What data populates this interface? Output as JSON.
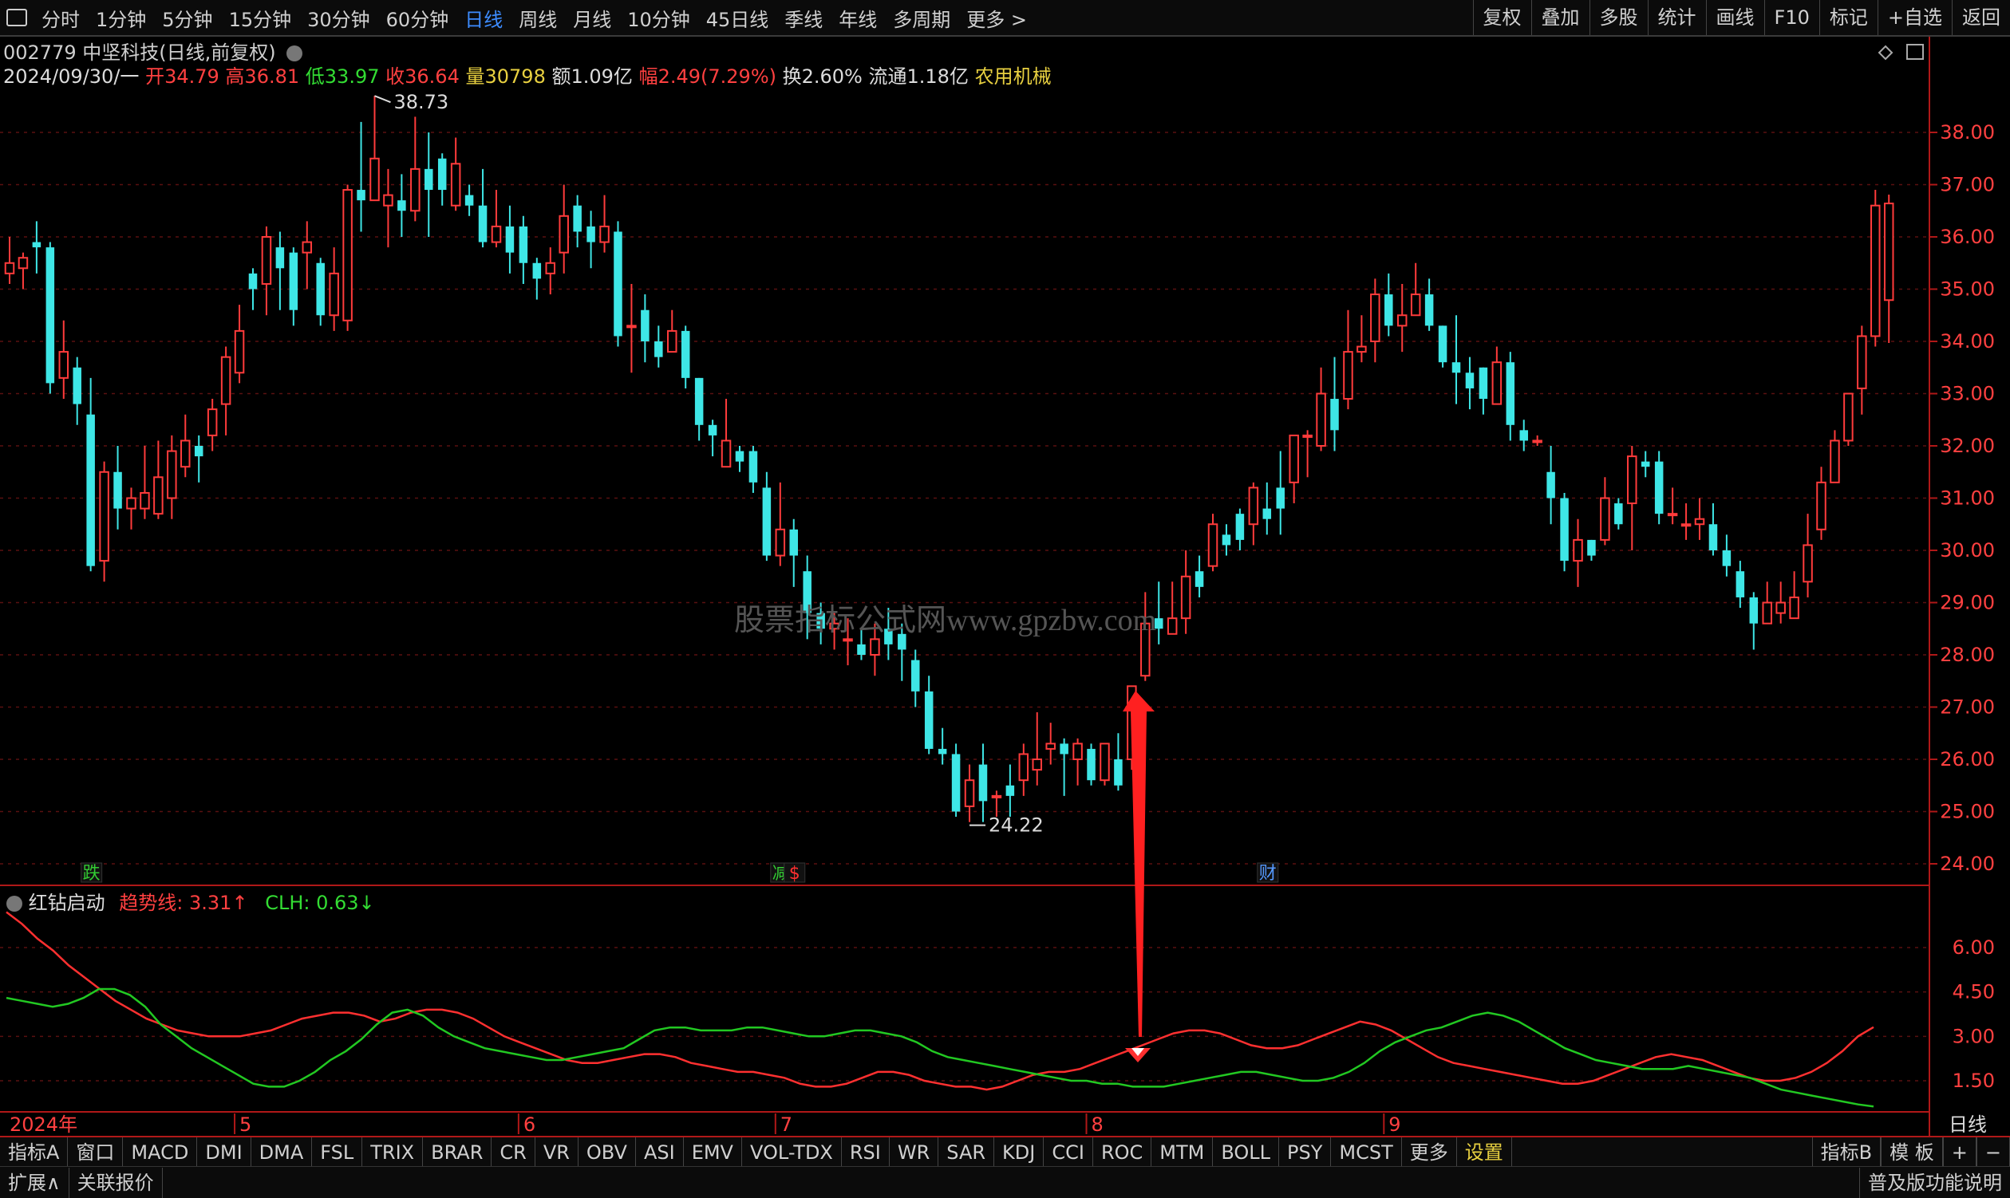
{
  "topbar": {
    "periods": [
      "分时",
      "1分钟",
      "5分钟",
      "15分钟",
      "30分钟",
      "60分钟",
      "日线",
      "周线",
      "月线",
      "10分钟",
      "45日线",
      "季线",
      "年线",
      "多周期",
      "更多 >"
    ],
    "active_period": "日线",
    "right_tools": [
      "复权",
      "叠加",
      "多股",
      "统计",
      "画线",
      "F10",
      "标记",
      "+自选",
      "返回"
    ]
  },
  "stock": {
    "title": "002779 中坚科技(日线,前复权)",
    "date": "2024/09/30/一",
    "open_label": "开",
    "open": "34.79",
    "high_label": "高",
    "high": "36.81",
    "low_label": "低",
    "low": "33.97",
    "close_label": "收",
    "close": "36.64",
    "vol_label": "量",
    "vol": "30798",
    "amount": "额1.09亿",
    "change_label": "幅",
    "change": "2.49(7.29%)",
    "turnover": "换2.60%",
    "float": "流通1.18亿",
    "sector": "农用机械"
  },
  "watermark": "股票指标公式网www.gpzbw.com",
  "colors": {
    "up": "#ff3b3b",
    "down": "#3ee6e6",
    "grid": "#5a1010",
    "axis": "#b01818",
    "trend": "#ff3030",
    "clh": "#22c822"
  },
  "indicator": {
    "name": "红钻启动",
    "trend_label": "趋势线:",
    "trend_value": "3.31",
    "clh_label": "CLH:",
    "clh_value": "0.63"
  },
  "chart_data": {
    "type": "candlestick",
    "price_axis_ticks": [
      "38.00",
      "37.00",
      "36.00",
      "35.00",
      "34.00",
      "33.00",
      "32.00",
      "31.00",
      "30.00",
      "29.00",
      "28.00",
      "27.00",
      "26.00",
      "25.00",
      "24.00"
    ],
    "price_range": [
      23.8,
      39.5
    ],
    "indicator_ticks": [
      "6.00",
      "4.50",
      "3.00",
      "1.50"
    ],
    "indicator_range": [
      0.6,
      7.6
    ],
    "month_labels": [
      [
        "2024年",
        0
      ],
      [
        "5",
        17
      ],
      [
        "6",
        38
      ],
      [
        "7",
        57
      ],
      [
        "8",
        80
      ],
      [
        "9",
        102
      ]
    ],
    "annotations": {
      "high": "38.73",
      "low": "24.22"
    },
    "event_marks": [
      [
        "跌",
        6,
        "#33cc33"
      ],
      [
        "减",
        57,
        "#33cc33"
      ],
      [
        "$",
        58,
        "#ff3030"
      ],
      [
        "财",
        93,
        "#5599ff"
      ]
    ],
    "candles": [
      [
        35.3,
        35.5,
        35.1,
        36.0
      ],
      [
        35.4,
        35.6,
        35.0,
        35.7
      ],
      [
        35.9,
        35.8,
        35.3,
        36.3
      ],
      [
        35.8,
        33.2,
        33.0,
        35.9
      ],
      [
        33.3,
        33.8,
        32.9,
        34.4
      ],
      [
        33.5,
        32.8,
        32.4,
        33.7
      ],
      [
        32.6,
        29.7,
        29.6,
        33.3
      ],
      [
        29.8,
        31.5,
        29.4,
        31.7
      ],
      [
        31.5,
        30.8,
        30.4,
        32.0
      ],
      [
        30.8,
        31.0,
        30.4,
        31.2
      ],
      [
        30.8,
        31.1,
        30.6,
        32.0
      ],
      [
        30.7,
        31.4,
        30.6,
        32.1
      ],
      [
        31.0,
        31.9,
        30.6,
        32.2
      ],
      [
        31.6,
        32.1,
        31.4,
        32.6
      ],
      [
        32.0,
        31.8,
        31.3,
        32.2
      ],
      [
        32.2,
        32.7,
        31.9,
        32.9
      ],
      [
        32.8,
        33.7,
        32.2,
        33.9
      ],
      [
        33.4,
        34.2,
        33.2,
        34.7
      ],
      [
        35.3,
        35.0,
        34.6,
        35.4
      ],
      [
        35.1,
        36.0,
        34.5,
        36.2
      ],
      [
        35.8,
        35.4,
        34.6,
        36.1
      ],
      [
        35.7,
        34.6,
        34.3,
        35.8
      ],
      [
        35.7,
        35.9,
        35.0,
        36.3
      ],
      [
        35.5,
        34.5,
        34.3,
        35.6
      ],
      [
        34.5,
        35.3,
        34.2,
        35.8
      ],
      [
        34.4,
        36.9,
        34.2,
        37.0
      ],
      [
        36.9,
        36.7,
        36.1,
        38.2
      ],
      [
        36.7,
        37.5,
        36.7,
        38.7
      ],
      [
        36.6,
        36.8,
        35.8,
        37.3
      ],
      [
        36.7,
        36.5,
        36.0,
        37.2
      ],
      [
        36.5,
        37.3,
        36.3,
        38.3
      ],
      [
        37.3,
        36.9,
        36.0,
        38.0
      ],
      [
        37.5,
        36.9,
        36.6,
        37.6
      ],
      [
        36.6,
        37.4,
        36.5,
        37.9
      ],
      [
        36.8,
        36.6,
        36.4,
        37.0
      ],
      [
        36.6,
        35.9,
        35.8,
        37.3
      ],
      [
        35.9,
        36.2,
        35.8,
        36.9
      ],
      [
        36.2,
        35.7,
        35.3,
        36.6
      ],
      [
        36.2,
        35.5,
        35.1,
        36.4
      ],
      [
        35.5,
        35.2,
        34.8,
        35.6
      ],
      [
        35.3,
        35.5,
        34.9,
        35.8
      ],
      [
        35.7,
        36.4,
        35.3,
        37.0
      ],
      [
        36.6,
        36.1,
        35.8,
        36.8
      ],
      [
        36.2,
        35.9,
        35.4,
        36.5
      ],
      [
        35.9,
        36.2,
        35.7,
        36.8
      ],
      [
        36.1,
        34.1,
        33.9,
        36.3
      ],
      [
        34.3,
        34.3,
        33.4,
        35.1
      ],
      [
        34.6,
        34.0,
        33.6,
        34.9
      ],
      [
        34.0,
        33.7,
        33.5,
        34.3
      ],
      [
        33.8,
        34.2,
        33.8,
        34.6
      ],
      [
        34.2,
        33.3,
        33.1,
        34.3
      ],
      [
        33.3,
        32.4,
        32.1,
        33.3
      ],
      [
        32.4,
        32.2,
        31.8,
        32.5
      ],
      [
        31.6,
        32.1,
        31.6,
        32.9
      ],
      [
        31.9,
        31.7,
        31.5,
        32.0
      ],
      [
        31.9,
        31.3,
        31.1,
        32.0
      ],
      [
        31.2,
        29.9,
        29.8,
        31.5
      ],
      [
        29.9,
        30.4,
        29.7,
        31.3
      ],
      [
        30.4,
        29.9,
        29.3,
        30.6
      ],
      [
        29.6,
        28.8,
        28.3,
        29.9
      ],
      [
        28.8,
        28.5,
        28.2,
        29.0
      ],
      [
        28.5,
        28.6,
        28.1,
        28.8
      ],
      [
        28.3,
        28.3,
        27.8,
        28.7
      ],
      [
        28.2,
        28.0,
        27.9,
        28.5
      ],
      [
        28.0,
        28.3,
        27.6,
        28.6
      ],
      [
        28.5,
        28.2,
        27.9,
        28.9
      ],
      [
        28.4,
        28.1,
        27.5,
        28.6
      ],
      [
        27.9,
        27.3,
        27.0,
        28.1
      ],
      [
        27.3,
        26.2,
        26.1,
        27.6
      ],
      [
        26.2,
        26.1,
        25.9,
        26.6
      ],
      [
        26.1,
        25.0,
        24.9,
        26.3
      ],
      [
        25.1,
        25.6,
        24.8,
        25.9
      ],
      [
        25.9,
        25.2,
        24.8,
        26.3
      ],
      [
        25.3,
        25.3,
        24.9,
        25.4
      ],
      [
        25.5,
        25.3,
        24.9,
        25.9
      ],
      [
        25.6,
        26.1,
        25.3,
        26.3
      ],
      [
        25.8,
        26.0,
        25.5,
        26.9
      ],
      [
        26.2,
        26.3,
        25.9,
        26.7
      ],
      [
        26.3,
        26.1,
        25.3,
        26.4
      ],
      [
        26.0,
        26.3,
        25.5,
        26.4
      ],
      [
        26.2,
        25.6,
        25.5,
        26.3
      ],
      [
        25.6,
        26.3,
        25.5,
        26.3
      ],
      [
        26.0,
        25.5,
        25.4,
        26.5
      ],
      [
        26.0,
        27.4,
        25.8,
        27.4
      ],
      [
        27.6,
        28.6,
        27.5,
        29.2
      ],
      [
        28.7,
        28.5,
        28.2,
        29.4
      ],
      [
        28.4,
        28.7,
        28.4,
        29.4
      ],
      [
        28.7,
        29.5,
        28.4,
        30.0
      ],
      [
        29.6,
        29.3,
        29.1,
        29.9
      ],
      [
        29.7,
        30.5,
        29.6,
        30.7
      ],
      [
        30.3,
        30.1,
        29.9,
        30.5
      ],
      [
        30.7,
        30.2,
        30.0,
        30.8
      ],
      [
        30.5,
        31.2,
        30.1,
        31.3
      ],
      [
        30.8,
        30.6,
        30.3,
        31.3
      ],
      [
        31.2,
        30.8,
        30.3,
        31.9
      ],
      [
        31.3,
        32.2,
        30.9,
        32.2
      ],
      [
        32.2,
        32.2,
        31.4,
        32.3
      ],
      [
        32.0,
        33.0,
        31.9,
        33.5
      ],
      [
        32.9,
        32.3,
        31.9,
        33.7
      ],
      [
        32.9,
        33.8,
        32.7,
        34.6
      ],
      [
        33.8,
        33.9,
        33.6,
        34.5
      ],
      [
        34.0,
        34.9,
        33.6,
        35.2
      ],
      [
        34.9,
        34.3,
        34.1,
        35.3
      ],
      [
        34.3,
        34.5,
        33.8,
        35.1
      ],
      [
        34.5,
        34.9,
        34.5,
        35.5
      ],
      [
        34.9,
        34.3,
        34.2,
        35.2
      ],
      [
        34.3,
        33.6,
        33.5,
        34.3
      ],
      [
        33.6,
        33.4,
        32.8,
        34.5
      ],
      [
        33.4,
        33.1,
        32.7,
        33.7
      ],
      [
        33.5,
        32.9,
        32.6,
        33.5
      ],
      [
        32.8,
        33.6,
        32.8,
        33.9
      ],
      [
        33.6,
        32.4,
        32.1,
        33.8
      ],
      [
        32.3,
        32.1,
        31.9,
        32.5
      ],
      [
        32.1,
        32.1,
        32.0,
        32.2
      ],
      [
        31.5,
        31.0,
        30.5,
        32.0
      ],
      [
        31.0,
        29.8,
        29.6,
        31.1
      ],
      [
        29.8,
        30.2,
        29.3,
        30.6
      ],
      [
        30.2,
        29.9,
        29.8,
        30.2
      ],
      [
        30.2,
        31.0,
        30.1,
        31.4
      ],
      [
        30.9,
        30.5,
        30.4,
        31.0
      ],
      [
        30.9,
        31.8,
        30.0,
        32.0
      ],
      [
        31.7,
        31.6,
        31.4,
        31.9
      ],
      [
        31.7,
        30.7,
        30.5,
        31.9
      ],
      [
        30.7,
        30.7,
        30.5,
        31.2
      ],
      [
        30.5,
        30.5,
        30.2,
        30.9
      ],
      [
        30.5,
        30.6,
        30.2,
        31.0
      ],
      [
        30.5,
        30.0,
        29.9,
        30.9
      ],
      [
        30.0,
        29.7,
        29.5,
        30.3
      ],
      [
        29.6,
        29.1,
        28.9,
        29.8
      ],
      [
        29.1,
        28.6,
        28.1,
        29.2
      ],
      [
        28.6,
        29.0,
        28.6,
        29.4
      ],
      [
        28.8,
        29.0,
        28.6,
        29.4
      ],
      [
        28.7,
        29.1,
        28.7,
        29.6
      ],
      [
        29.4,
        30.1,
        29.1,
        30.7
      ],
      [
        30.4,
        31.3,
        30.2,
        31.6
      ],
      [
        31.3,
        32.1,
        31.6,
        32.3
      ],
      [
        32.1,
        33.0,
        32.0,
        33.0
      ],
      [
        33.1,
        34.1,
        32.6,
        34.3
      ],
      [
        34.1,
        36.6,
        33.9,
        36.9
      ],
      [
        34.79,
        36.64,
        33.97,
        36.81
      ]
    ],
    "trend_line": [
      7.2,
      6.8,
      6.3,
      5.9,
      5.4,
      5.0,
      4.6,
      4.2,
      3.9,
      3.6,
      3.4,
      3.2,
      3.1,
      3.0,
      3.0,
      3.0,
      3.1,
      3.2,
      3.4,
      3.6,
      3.7,
      3.8,
      3.8,
      3.7,
      3.5,
      3.6,
      3.8,
      3.9,
      3.9,
      3.8,
      3.6,
      3.3,
      3.0,
      2.8,
      2.6,
      2.4,
      2.2,
      2.1,
      2.1,
      2.2,
      2.3,
      2.4,
      2.4,
      2.3,
      2.1,
      2.0,
      1.9,
      1.8,
      1.8,
      1.7,
      1.6,
      1.4,
      1.3,
      1.3,
      1.4,
      1.6,
      1.8,
      1.8,
      1.7,
      1.5,
      1.4,
      1.3,
      1.3,
      1.2,
      1.3,
      1.5,
      1.7,
      1.8,
      1.8,
      1.9,
      2.1,
      2.3,
      2.5,
      2.7,
      2.9,
      3.1,
      3.2,
      3.2,
      3.1,
      2.9,
      2.7,
      2.6,
      2.6,
      2.7,
      2.9,
      3.1,
      3.3,
      3.5,
      3.4,
      3.2,
      2.9,
      2.6,
      2.3,
      2.1,
      2.0,
      1.9,
      1.8,
      1.7,
      1.6,
      1.5,
      1.4,
      1.4,
      1.5,
      1.7,
      1.9,
      2.1,
      2.3,
      2.4,
      2.3,
      2.2,
      2.0,
      1.8,
      1.6,
      1.5,
      1.5,
      1.6,
      1.8,
      2.1,
      2.5,
      3.0,
      3.31
    ],
    "clh_line": [
      4.3,
      4.2,
      4.1,
      4.0,
      4.1,
      4.3,
      4.6,
      4.6,
      4.4,
      4.0,
      3.4,
      3.0,
      2.6,
      2.3,
      2.0,
      1.7,
      1.4,
      1.3,
      1.3,
      1.5,
      1.8,
      2.2,
      2.5,
      2.9,
      3.4,
      3.8,
      3.9,
      3.7,
      3.3,
      3.0,
      2.8,
      2.6,
      2.5,
      2.4,
      2.3,
      2.2,
      2.2,
      2.3,
      2.4,
      2.5,
      2.6,
      2.9,
      3.2,
      3.3,
      3.3,
      3.2,
      3.2,
      3.2,
      3.3,
      3.3,
      3.2,
      3.1,
      3.0,
      3.0,
      3.1,
      3.2,
      3.2,
      3.1,
      3.0,
      2.8,
      2.5,
      2.3,
      2.2,
      2.1,
      2.0,
      1.9,
      1.8,
      1.7,
      1.6,
      1.5,
      1.5,
      1.4,
      1.4,
      1.3,
      1.3,
      1.3,
      1.4,
      1.5,
      1.6,
      1.7,
      1.8,
      1.8,
      1.7,
      1.6,
      1.5,
      1.5,
      1.6,
      1.8,
      2.1,
      2.5,
      2.8,
      3.0,
      3.2,
      3.3,
      3.5,
      3.7,
      3.8,
      3.7,
      3.5,
      3.2,
      2.9,
      2.6,
      2.4,
      2.2,
      2.1,
      2.0,
      1.9,
      1.9,
      1.9,
      2.0,
      1.9,
      1.8,
      1.7,
      1.6,
      1.4,
      1.2,
      1.1,
      1.0,
      0.9,
      0.8,
      0.7,
      0.63
    ]
  },
  "bottom_tabs": [
    "指标A",
    "窗口",
    "MACD",
    "DMI",
    "DMA",
    "FSL",
    "TRIX",
    "BRAR",
    "CR",
    "VR",
    "OBV",
    "ASI",
    "EMV",
    "VOL-TDX",
    "RSI",
    "WR",
    "SAR",
    "KDJ",
    "CCI",
    "ROC",
    "MTM",
    "BOLL",
    "PSY",
    "MCST",
    "更多",
    "设置"
  ],
  "bottom_right": [
    "指标B",
    "模 板",
    "+",
    "−"
  ],
  "period_label": "日线",
  "footer": {
    "expand": "扩展∧",
    "quote": "关联报价",
    "right": "普及版功能说明"
  }
}
